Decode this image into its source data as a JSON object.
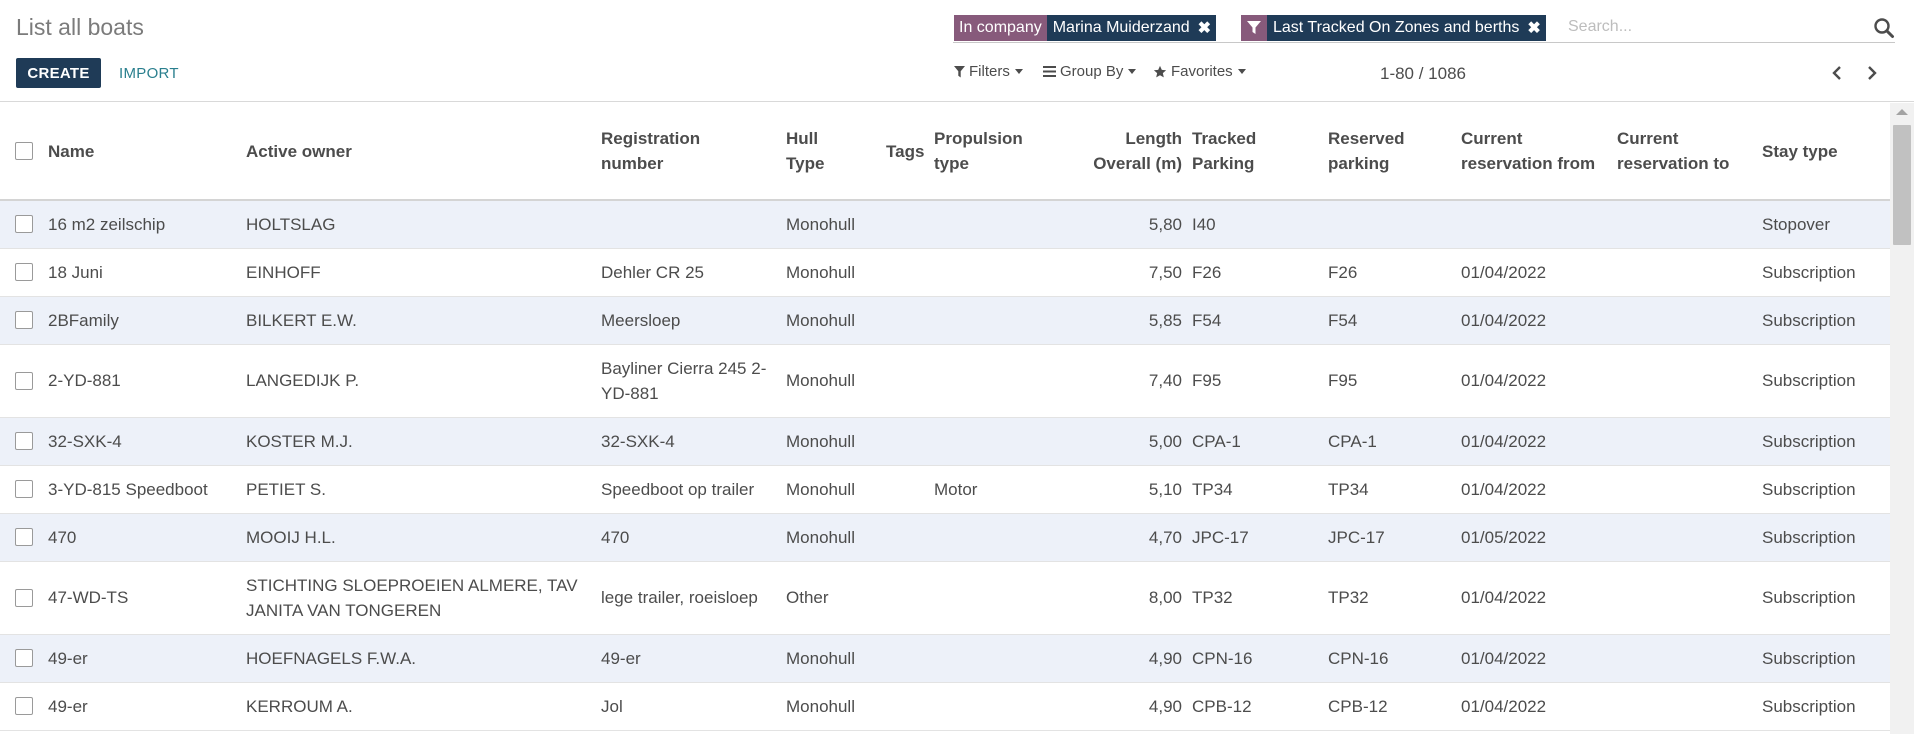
{
  "header": {
    "title": "List all boats",
    "create_label": "CREATE",
    "import_label": "IMPORT"
  },
  "search": {
    "facets": [
      {
        "label": "In company",
        "value": "Marina Muiderzand"
      },
      {
        "label_icon": "filter-icon",
        "value": "Last Tracked On Zones and berths"
      }
    ],
    "placeholder": "Search..."
  },
  "toolbar": {
    "filters_label": "Filters",
    "groupby_label": "Group By",
    "favorites_label": "Favorites"
  },
  "pager": {
    "value": "1-80 / 1086"
  },
  "columns": {
    "name": "Name",
    "owner": "Active owner",
    "registration_1": "Registration",
    "registration_2": "number",
    "hull_1": "Hull",
    "hull_2": "Type",
    "tags": "Tags",
    "propulsion_1": "Propulsion",
    "propulsion_2": "type",
    "length_1": "Length",
    "length_2": "Overall (m)",
    "tracked_1": "Tracked",
    "tracked_2": "Parking",
    "reserved_1": "Reserved",
    "reserved_2": "parking",
    "res_from_1": "Current",
    "res_from_2": "reservation from",
    "res_to_1": "Current",
    "res_to_2": "reservation to",
    "stay": "Stay type"
  },
  "rows": [
    {
      "name": "16 m2 zeilschip",
      "owner": "HOLTSLAG",
      "registration": "",
      "hull": "Monohull",
      "tags": "",
      "propulsion": "",
      "length": "5,80",
      "tracked": "I40",
      "reserved": "",
      "res_from": "",
      "res_to": "",
      "stay": "Stopover"
    },
    {
      "name": "18 Juni",
      "owner": "EINHOFF",
      "registration": "Dehler CR 25",
      "hull": "Monohull",
      "tags": "",
      "propulsion": "",
      "length": "7,50",
      "tracked": "F26",
      "reserved": "F26",
      "res_from": "01/04/2022",
      "res_to": "",
      "stay": "Subscription"
    },
    {
      "name": "2BFamily",
      "owner": "BILKERT E.W.",
      "registration": "Meersloep",
      "hull": "Monohull",
      "tags": "",
      "propulsion": "",
      "length": "5,85",
      "tracked": "F54",
      "reserved": "F54",
      "res_from": "01/04/2022",
      "res_to": "",
      "stay": "Subscription"
    },
    {
      "name": "2-YD-881",
      "owner": "LANGEDIJK P.",
      "registration": "Bayliner Cierra 245 2-YD-881",
      "hull": "Monohull",
      "tags": "",
      "propulsion": "",
      "length": "7,40",
      "tracked": "F95",
      "reserved": "F95",
      "res_from": "01/04/2022",
      "res_to": "",
      "stay": "Subscription"
    },
    {
      "name": "32-SXK-4",
      "owner": "KOSTER M.J.",
      "registration": "32-SXK-4",
      "hull": "Monohull",
      "tags": "",
      "propulsion": "",
      "length": "5,00",
      "tracked": "CPA-1",
      "reserved": "CPA-1",
      "res_from": "01/04/2022",
      "res_to": "",
      "stay": "Subscription"
    },
    {
      "name": "3-YD-815 Speedboot",
      "owner": "PETIET S.",
      "registration": "Speedboot op trailer",
      "hull": "Monohull",
      "tags": "",
      "propulsion": "Motor",
      "length": "5,10",
      "tracked": "TP34",
      "reserved": "TP34",
      "res_from": "01/04/2022",
      "res_to": "",
      "stay": "Subscription"
    },
    {
      "name": "470",
      "owner": "MOOIJ H.L.",
      "registration": "470",
      "hull": "Monohull",
      "tags": "",
      "propulsion": "",
      "length": "4,70",
      "tracked": "JPC-17",
      "reserved": "JPC-17",
      "res_from": "01/05/2022",
      "res_to": "",
      "stay": "Subscription"
    },
    {
      "name": "47-WD-TS",
      "owner": "STICHTING SLOEPROEIEN ALMERE, TAV JANITA VAN TONGEREN",
      "registration": "lege trailer, roeisloep",
      "hull": "Other",
      "tags": "",
      "propulsion": "",
      "length": "8,00",
      "tracked": "TP32",
      "reserved": "TP32",
      "res_from": "01/04/2022",
      "res_to": "",
      "stay": "Subscription"
    },
    {
      "name": "49-er",
      "owner": "HOEFNAGELS F.W.A.",
      "registration": "49-er",
      "hull": "Monohull",
      "tags": "",
      "propulsion": "",
      "length": "4,90",
      "tracked": "CPN-16",
      "reserved": "CPN-16",
      "res_from": "01/04/2022",
      "res_to": "",
      "stay": "Subscription"
    },
    {
      "name": "49-er",
      "owner": "KERROUM A.",
      "registration": "Jol",
      "hull": "Monohull",
      "tags": "",
      "propulsion": "",
      "length": "4,90",
      "tracked": "CPB-12",
      "reserved": "CPB-12",
      "res_from": "01/04/2022",
      "res_to": "",
      "stay": "Subscription"
    }
  ]
}
